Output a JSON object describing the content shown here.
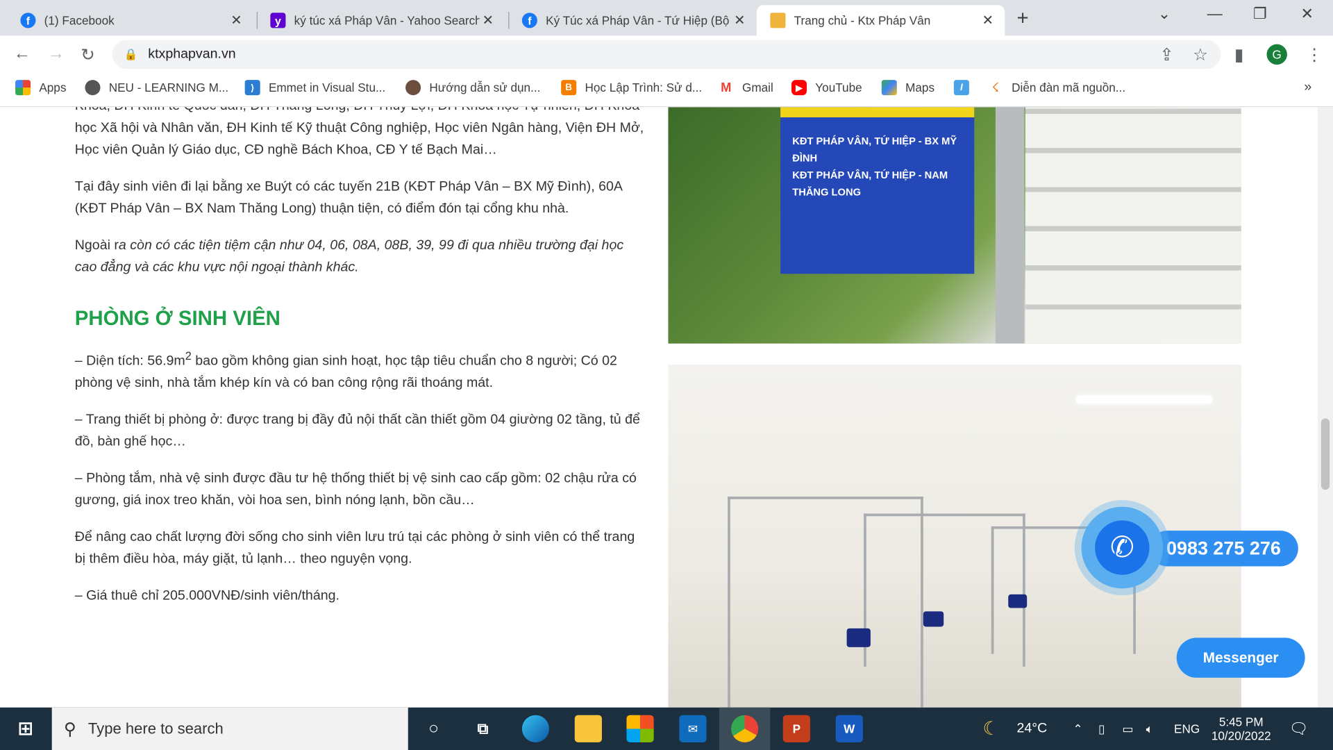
{
  "tabs": [
    {
      "title": "(1) Facebook",
      "icon": "facebook-icon"
    },
    {
      "title": "ký túc xá Pháp Vân - Yahoo Search",
      "icon": "yahoo-icon"
    },
    {
      "title": "Ký Túc xá Pháp Vân - Tứ Hiệp (Bộ",
      "icon": "facebook-icon"
    },
    {
      "title": "Trang chủ - Ktx Pháp Vân",
      "icon": "ktx-logo-icon"
    }
  ],
  "address": {
    "url": "ktxphapvan.vn"
  },
  "profile_initial": "G",
  "bookmarks": [
    {
      "label": "Apps"
    },
    {
      "label": "NEU - LEARNING M..."
    },
    {
      "label": "Emmet in Visual Stu..."
    },
    {
      "label": "Hướng dẫn sử dụn..."
    },
    {
      "label": "Học Lập Trình: Sử d..."
    },
    {
      "label": "Gmail"
    },
    {
      "label": "YouTube"
    },
    {
      "label": "Maps"
    },
    {
      "label": "Diễn đàn mã nguồn..."
    }
  ],
  "content": {
    "p0": "Khoa, ĐH Kinh tế Quốc dân, ĐH Thăng Long, ĐH Thủy Lợi, ĐH Khoa học Tự nhiên, ĐH Khoa học Xã hội và Nhân văn, ĐH Kinh tế Kỹ thuật Công nghiệp, Học viên Ngân hàng, Viện ĐH Mở, Học viên Quản lý Giáo dục, CĐ nghề Bách Khoa, CĐ Y tế Bạch Mai…",
    "p1": "Tại đây sinh viên đi lại bằng xe Buýt có các tuyến 21B (KĐT Pháp Vân – BX Mỹ Đình), 60A (KĐT Pháp Vân – BX Nam Thăng Long) thuận tiện, có điểm đón tại cổng khu nhà.",
    "p2_plain": "Ngoài r",
    "p2_italic": "a còn có các tiện tiệm cận như 04, 06, 08A, 08B, 39, 99 đi qua nhiều trường đại học cao đẳng và các khu vực nội ngoại thành khác.",
    "heading": "PHÒNG Ở SINH VIÊN",
    "b1_pre": "– Diện tích: 56.9m",
    "b1_sup": "2",
    "b1_post": " bao gồm không gian sinh hoạt, học tập tiêu chuẩn cho 8 người; Có 02 phòng vệ sinh, nhà tắm khép kín và có ban công rộng rãi thoáng mát.",
    "b2": "– Trang thiết bị phòng ở: được trang bị đầy đủ nội thất cần thiết gồm 04 giường 02 tầng, tủ để đồ, bàn ghế học…",
    "b3": "– Phòng tắm, nhà vệ sinh được đầu tư hệ thống thiết bị vệ sinh cao cấp gồm: 02 chậu rửa có gương, giá inox treo khăn, vòi hoa sen, bình nóng lạnh, bồn cầu…",
    "b4": "Để nâng cao chất lượng đời sống cho sinh viên lưu trú tại các phòng ở sinh viên có thể trang bị thêm điều hòa, máy giặt, tủ lạnh… theo nguyện vọng.",
    "b5": "– Giá thuê chỉ 205.000VNĐ/sinh viên/tháng."
  },
  "bus_sign": {
    "line1": "KĐT PHÁP VÂN, TỨ HIỆP - BX MỸ ĐÌNH",
    "line2": "KĐT PHÁP VÂN, TỨ HIỆP - NAM THĂNG LONG"
  },
  "phone_number": "0983 275 276",
  "messenger_label": "Messenger",
  "taskbar": {
    "search_placeholder": "Type here to search",
    "weather": "24°C",
    "lang": "ENG",
    "time": "5:45 PM",
    "date": "10/20/2022"
  },
  "colors": {
    "heading": "#1fa14a",
    "phone": "#2f8ef0",
    "taskbar": "#1c2f3f"
  }
}
